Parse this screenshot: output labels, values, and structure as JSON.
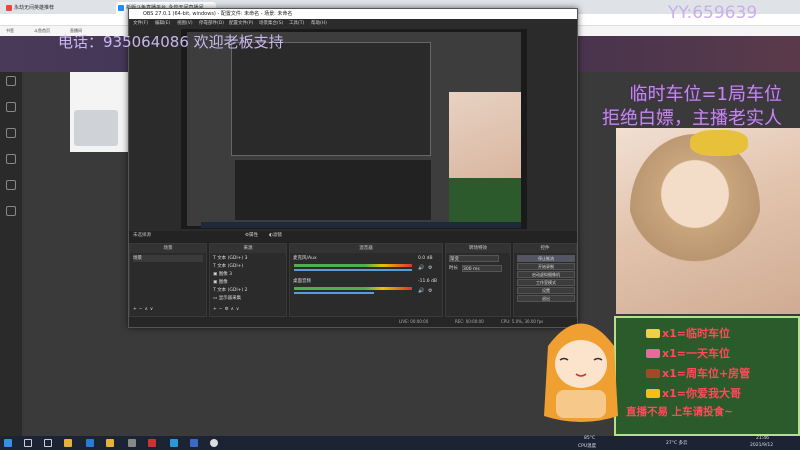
{
  "browser": {
    "tabs": [
      {
        "label": "永劫无间英雄推荐",
        "color": "#e44"
      },
      {
        "label": "新版斗鱼直播平台_永劫无间直播间",
        "color": "#1e90ff",
        "active": true
      }
    ],
    "bookmarks": [
      "书签",
      "斗鱼首页",
      "直播间"
    ]
  },
  "watermark": {
    "yy": "YY:659639",
    "phone": "电话：935064086 欢迎老板支持"
  },
  "obs": {
    "title": "OBS 27.0.1 (64-bit, windows) - 配置文件: 未命名 - 场景: 未命名",
    "menu": [
      "文件(F)",
      "编辑(E)",
      "视图(V)",
      "停靠部件(D)",
      "配置文件(P)",
      "场景集合(S)",
      "工具(T)",
      "帮助(H)"
    ],
    "sources_toolbar": [
      "属性",
      "滤镜"
    ],
    "no_source": "未选择源",
    "scenes_header": "场景",
    "scene_item": "场景",
    "sources_header": "来源",
    "sources": [
      "文本 (GDI+) 3",
      "文本 (GDI+)",
      "图像 3",
      "图像",
      "文本 (GDI+) 2",
      "显示器采集"
    ],
    "mixer_header": "混音器",
    "mixer": [
      {
        "name": "麦克风/Aux",
        "level": "0.0 dB"
      },
      {
        "name": "桌面音频",
        "level": "-11.6 dB"
      }
    ],
    "transition_header": "转场特效",
    "transition_fade": "渐变",
    "transition_duration_label": "时长",
    "transition_duration": "300 ms",
    "controls_header": "控件",
    "controls": [
      "停止推流",
      "开始录制",
      "启动虚拟摄像机",
      "工作室模式",
      "设置",
      "退出"
    ],
    "status": {
      "live": "LIVE: 00:00:00",
      "rec": "REC: 00:00:00",
      "cpu": "CPU: 5.0%, 30.00 fps"
    }
  },
  "stream": {
    "headline": [
      "临时车位=1局车位",
      "拒绝白嫖，主播老实人"
    ],
    "promo": [
      {
        "text": "x1=临时车位",
        "color": "#f0d04a"
      },
      {
        "text": "x1=一天车位",
        "color": "#e86a9a"
      },
      {
        "text": "x1=周车位+房管",
        "color": "#a04a2a"
      },
      {
        "text": "x1=你爱我大哥",
        "color": "#f0c020"
      }
    ],
    "promo_footer": "直播不易 上车请投食~"
  },
  "taskbar": {
    "weather": "27°C 多云",
    "time": "21:46",
    "date": "2021/9/12",
    "cpu_temp": "85°C",
    "cpu_label": "CPU温度"
  },
  "colors": {
    "accent_purple": "#c08be6",
    "promo_red": "#ff4a5a",
    "promo_bg": "#2b5a2b"
  }
}
